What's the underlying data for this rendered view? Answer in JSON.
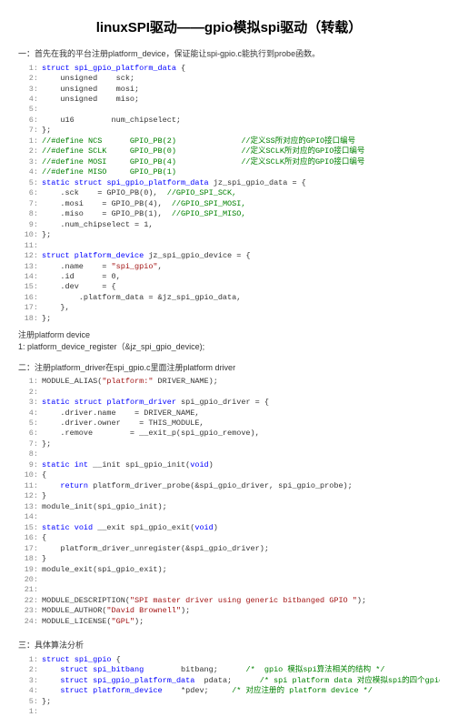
{
  "title": "linuxSPI驱动——gpio模拟spi驱动（转载）",
  "intro1": "一：首先在我的平台注册platform_device，保证能让spi-gpio.c能执行到probe函数。",
  "block1": [
    {
      "n": "1:",
      "html": "<span class='kw'>struct</span> <span class='ty'>spi_gpio_platform_data</span> {"
    },
    {
      "n": "2:",
      "html": "<span class='pl'>    unsigned    sck;</span>"
    },
    {
      "n": "3:",
      "html": "<span class='pl'>    unsigned    mosi;</span>"
    },
    {
      "n": "4:",
      "html": "<span class='pl'>    unsigned    miso;</span>"
    },
    {
      "n": "5:",
      "html": ""
    },
    {
      "n": "6:",
      "html": "<span class='pl'>    u16        num_chipselect;</span>"
    },
    {
      "n": "7:",
      "html": "};"
    },
    {
      "n": "1:",
      "html": "<span class='cm'>//#define NCS      GPIO_PB(2)              //定义SS所对应的GPIO接口编号  </span>"
    },
    {
      "n": "2:",
      "html": "<span class='cm'>//#define SCLK     GPIO_PB(0)              //定义SCLK所对应的GPIO接口编号 </span>"
    },
    {
      "n": "3:",
      "html": "<span class='cm'>//#define MOSI     GPIO_PB(4)              //定义SCLK所对应的GPIO接口编号 </span>"
    },
    {
      "n": "4:",
      "html": "<span class='cm'>//#define MISO     GPIO_PB(1)</span>"
    },
    {
      "n": "5:",
      "html": "<span class='kw'>static</span> <span class='kw'>struct</span> <span class='ty'>spi_gpio_platform_data</span> jz_spi_gpio_data = {"
    },
    {
      "n": "6:",
      "html": "    .sck    = GPIO_PB(0), <span class='cm'> //GPIO_SPI_SCK,</span>"
    },
    {
      "n": "7:",
      "html": "    .mosi    = GPIO_PB(4), <span class='cm'> //GPIO_SPI_MOSI,</span>"
    },
    {
      "n": "8:",
      "html": "    .miso    = GPIO_PB(1), <span class='cm'> //GPIO_SPI_MISO,</span>"
    },
    {
      "n": "9:",
      "html": "    .num_chipselect = 1,"
    },
    {
      "n": "10:",
      "html": "};"
    },
    {
      "n": "11:",
      "html": ""
    },
    {
      "n": "12:",
      "html": "<span class='kw'>struct</span> <span class='ty'>platform_device</span> jz_spi_gpio_device = {"
    },
    {
      "n": "13:",
      "html": "    .name    = <span class='str'>\"spi_gpio\"</span>,"
    },
    {
      "n": "14:",
      "html": "    .id      = 0,"
    },
    {
      "n": "15:",
      "html": "    .dev     = {"
    },
    {
      "n": "16:",
      "html": "        .platform_data = &jz_spi_gpio_data,"
    },
    {
      "n": "17:",
      "html": "    },"
    },
    {
      "n": "18:",
      "html": "};"
    }
  ],
  "reg_head": "注册platform device",
  "reg_line": "1: platform_device_register（&jz_spi_gpio_device);",
  "intro2": "二：注册platform_driver在spi_gpio.c里面注册platform driver",
  "block2": [
    {
      "n": "1:",
      "html": "MODULE_ALIAS(<span class='str'>\"platform:\"</span> DRIVER_NAME);"
    },
    {
      "n": "2:",
      "html": ""
    },
    {
      "n": "3:",
      "html": "<span class='kw'>static</span> <span class='kw'>struct</span> <span class='ty'>platform_driver</span> spi_gpio_driver = {"
    },
    {
      "n": "4:",
      "html": "    .driver.name    = DRIVER_NAME,"
    },
    {
      "n": "5:",
      "html": "    .driver.owner    = THIS_MODULE,"
    },
    {
      "n": "6:",
      "html": "    .remove        = __exit_p(spi_gpio_remove),"
    },
    {
      "n": "7:",
      "html": "};"
    },
    {
      "n": "8:",
      "html": ""
    },
    {
      "n": "9:",
      "html": "<span class='kw'>static</span> <span class='kw'>int</span> __init spi_gpio_init(<span class='kw'>void</span>)"
    },
    {
      "n": "10:",
      "html": "{"
    },
    {
      "n": "11:",
      "html": "    <span class='kw'>return</span> platform_driver_probe(&spi_gpio_driver, spi_gpio_probe);"
    },
    {
      "n": "12:",
      "html": "}"
    },
    {
      "n": "13:",
      "html": "module_init(spi_gpio_init);"
    },
    {
      "n": "14:",
      "html": ""
    },
    {
      "n": "15:",
      "html": "<span class='kw'>static</span> <span class='kw'>void</span> __exit spi_gpio_exit(<span class='kw'>void</span>)"
    },
    {
      "n": "16:",
      "html": "{"
    },
    {
      "n": "17:",
      "html": "    platform_driver_unregister(&spi_gpio_driver);"
    },
    {
      "n": "18:",
      "html": "}"
    },
    {
      "n": "19:",
      "html": "module_exit(spi_gpio_exit);"
    },
    {
      "n": "20:",
      "html": ""
    },
    {
      "n": "21:",
      "html": ""
    },
    {
      "n": "22:",
      "html": "MODULE_DESCRIPTION(<span class='str'>\"SPI master driver using generic bitbanged GPIO \"</span>);"
    },
    {
      "n": "23:",
      "html": "MODULE_AUTHOR(<span class='str'>\"David Brownell\"</span>);"
    },
    {
      "n": "24:",
      "html": "MODULE_LICENSE(<span class='str'>\"GPL\"</span>);"
    }
  ],
  "intro3": "三：具体算法分析",
  "block3": [
    {
      "n": "1:",
      "html": "<span class='kw'>struct</span> <span class='ty'>spi_gpio</span> {"
    },
    {
      "n": "2:",
      "html": "    <span class='kw'>struct</span> <span class='ty'>spi_bitbang</span>        bitbang;    <span class='cm'>  /*  gpio 模拟spi算法相关的结构 */</span>"
    },
    {
      "n": "3:",
      "html": "    <span class='kw'>struct</span> <span class='ty'>spi_gpio_platform_data</span>  pdata;     <span class='cm'> /* spi platform data 对应模拟spi的四个gpio编号 */</span>"
    },
    {
      "n": "4:",
      "html": "    <span class='kw'>struct</span> <span class='ty'>platform_device</span>    *pdev;    <span class='cm'> /* 对应注册的 platform device */</span>"
    },
    {
      "n": "5:",
      "html": "};"
    },
    {
      "n": "1:",
      "html": ""
    }
  ]
}
